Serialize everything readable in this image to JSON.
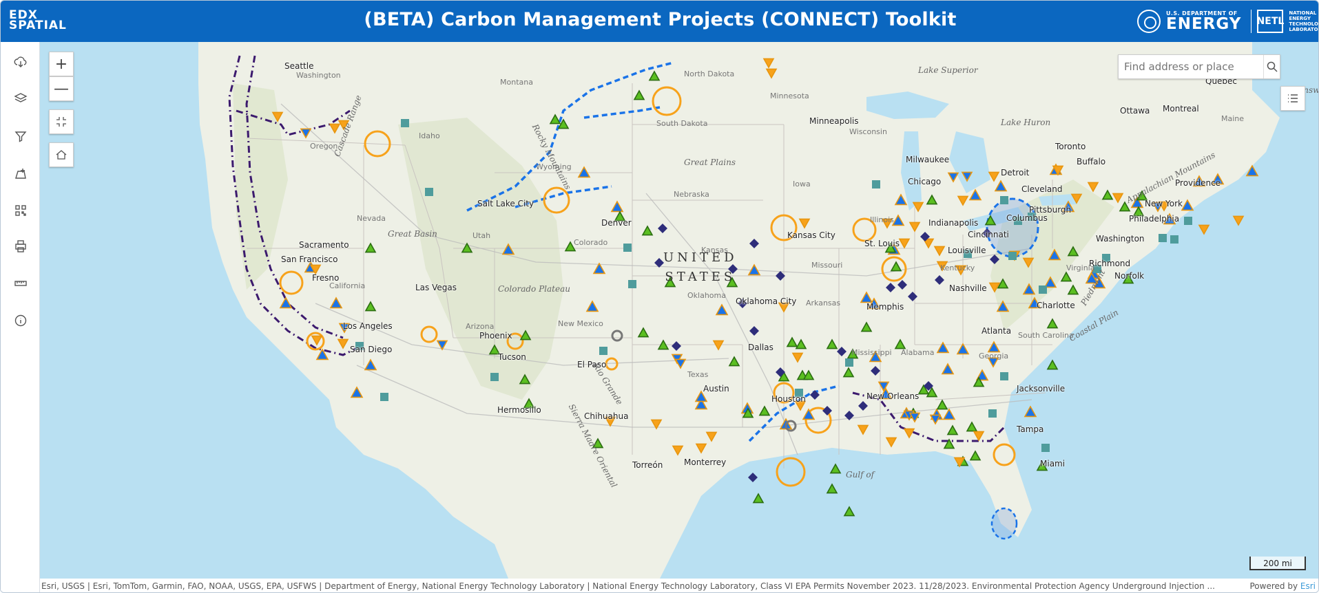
{
  "header": {
    "logo_line1": "EDX",
    "logo_line2": "SPATIAL",
    "title": "(BETA) Carbon Management Projects (CONNECT) Toolkit",
    "doe_small": "U.S. DEPARTMENT OF",
    "doe_big": "ENERGY",
    "netl_mark": "NETL",
    "netl_text": "NATIONAL ENERGY TECHNOLOGY LABORATORY"
  },
  "toolbar": {
    "tools": [
      "download-icon",
      "layers-icon",
      "filter-icon",
      "add-data-icon",
      "qr-code-icon",
      "print-icon",
      "measure-icon",
      "info-icon"
    ],
    "expand_glyph": "»"
  },
  "map_controls": {
    "zoom_in": "+",
    "zoom_out": "—",
    "search_placeholder": "Find address or place"
  },
  "map": {
    "country_label_line1": "UNITED",
    "country_label_line2": "STATES",
    "cities": [
      "Seattle",
      "Sacramento",
      "San Francisco",
      "Fresno",
      "Los Angeles",
      "San Diego",
      "Las Vegas",
      "Phoenix",
      "Tucson",
      "Salt Lake City",
      "Denver",
      "El Paso",
      "Hermosillo",
      "Chihuahua",
      "Torreón",
      "Monterrey",
      "Austin",
      "Houston",
      "Dallas",
      "Oklahoma City",
      "Kansas City",
      "Minneapolis",
      "Milwaukee",
      "Chicago",
      "St. Louis",
      "Memphis",
      "Nashville",
      "Louisville",
      "Indianapolis",
      "Cincinnati",
      "Columbus",
      "Cleveland",
      "Detroit",
      "Toronto",
      "Buffalo",
      "Pittsburgh",
      "New York",
      "Philadelphia",
      "Washington",
      "Richmond",
      "Norfolk",
      "Charlotte",
      "Atlanta",
      "Jacksonville",
      "Tampa",
      "Miami",
      "New Orleans",
      "Providence",
      "Ottawa",
      "Montreal",
      "Quebec"
    ],
    "states": [
      "Washington",
      "Oregon",
      "Idaho",
      "Montana",
      "Wyoming",
      "Nevada",
      "Utah",
      "Colorado",
      "California",
      "Arizona",
      "New Mexico",
      "Texas",
      "Oklahoma",
      "Kansas",
      "Nebraska",
      "South Dakota",
      "North Dakota",
      "Minnesota",
      "Iowa",
      "Missouri",
      "Arkansas",
      "Mississippi",
      "Alabama",
      "Georgia",
      "Kentucky",
      "Wisconsin",
      "Illinois",
      "Virginia",
      "South Carolina",
      "Maine"
    ],
    "geo_features": [
      "Great Plains",
      "Great Basin",
      "Rocky Mountains",
      "Colorado Plateau",
      "Cascade Range",
      "Appalachian Mountains",
      "Lake Superior",
      "Lake Huron",
      "Rio Grande",
      "Sierra Madre Oriental",
      "Gulf of",
      "Coastal Plain",
      "Piedmont",
      "Brunswick"
    ]
  },
  "scale": "200 mi",
  "attribution": "Esri, USGS | Esri, TomTom, Garmin, FAO, NOAA, USGS, EPA, USFWS | Department of Energy, National Energy Technology Laboratory | National Energy Technology Laboratory, Class VI EPA Permits November 2023. 11/28/2023. Environmental Protection Agency Underground Injection ...",
  "powered_by": "Powered by",
  "powered_by_brand": "Esri",
  "colors": {
    "header": "#0b67c0",
    "orange": "#f7a21b",
    "blue": "#1a73e8",
    "green": "#5bbf21",
    "navy": "#2e2d7a",
    "teal": "#4f9c9c",
    "purple": "#3c1a6e"
  }
}
